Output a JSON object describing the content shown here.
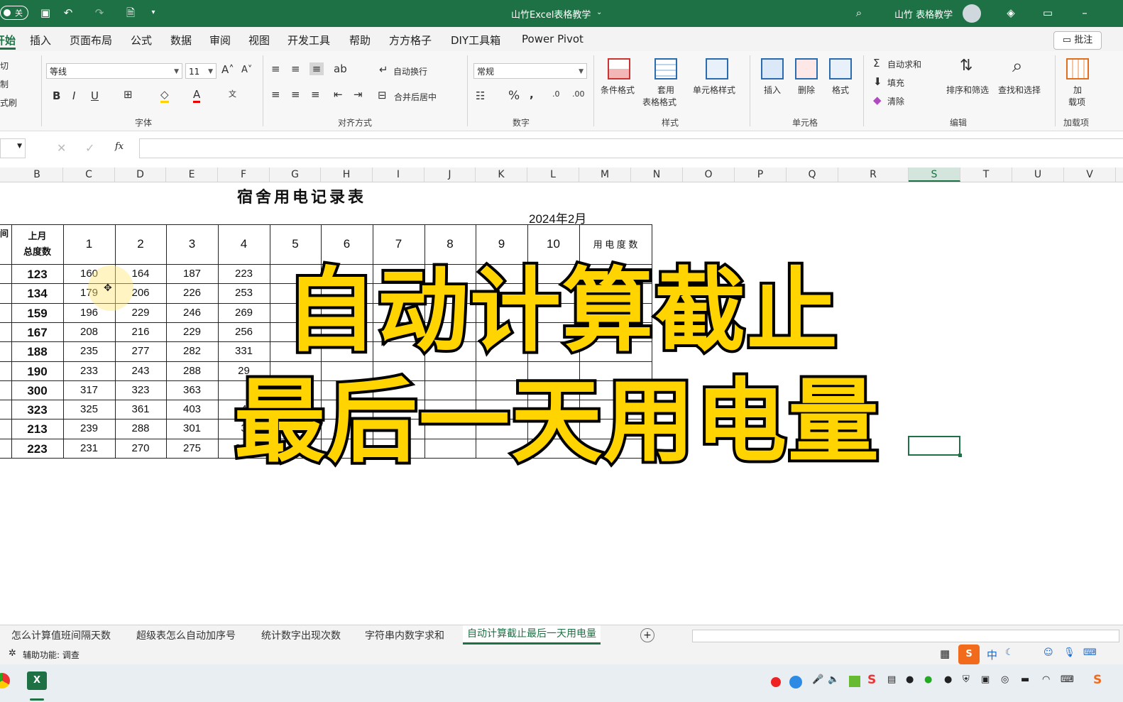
{
  "window": {
    "title": "山竹Excel表格教学",
    "autosave_label": "关",
    "user_name": "山竹 表格教学"
  },
  "menu": {
    "tabs": [
      "开始",
      "插入",
      "页面布局",
      "公式",
      "数据",
      "审阅",
      "视图",
      "开发工具",
      "帮助",
      "方方格子",
      "DIY工具箱",
      "Power Pivot"
    ],
    "active_tab": "开始",
    "comment_button": "批注"
  },
  "ribbon": {
    "clipboard": {
      "cut": "剪切",
      "copy": "复制",
      "format_painter": "格式刷"
    },
    "font": {
      "name": "等线",
      "size": "11",
      "label": "字体",
      "bold": "B",
      "italic": "I",
      "underline": "U"
    },
    "alignment": {
      "wrap_text": "自动换行",
      "merge_center": "合并后居中",
      "label": "对齐方式"
    },
    "number": {
      "format": "常规",
      "label": "数字",
      "percent": "%"
    },
    "styles": {
      "conditional": "条件格式",
      "table_format_1": "套用",
      "table_format_2": "表格格式",
      "cell_styles": "单元格样式",
      "label": "样式"
    },
    "cells": {
      "insert": "插入",
      "delete": "删除",
      "format": "格式",
      "label": "单元格"
    },
    "editing": {
      "autosum": "自动求和",
      "fill": "填充",
      "clear": "清除",
      "sort_filter": "排序和筛选",
      "find_select": "查找和选择",
      "label": "编辑"
    },
    "addins": {
      "label_1": "加",
      "label_2": "载项",
      "label": "加载项"
    }
  },
  "formula_bar": {
    "fx": "fx",
    "value": ""
  },
  "columns": [
    "B",
    "C",
    "D",
    "E",
    "F",
    "G",
    "H",
    "I",
    "J",
    "K",
    "L",
    "M",
    "N",
    "O",
    "P",
    "Q",
    "R",
    "S",
    "T",
    "U",
    "V"
  ],
  "selected_column": "S",
  "sheet": {
    "title": "宿舍用电记录表",
    "date": "2024年2月",
    "header_first_cell_fragment": "间",
    "header_prev_total_1": "上月",
    "header_prev_total_2": "总度数",
    "day_headers": [
      "1",
      "2",
      "3",
      "4",
      "5",
      "6",
      "7",
      "8",
      "9",
      "10"
    ],
    "last_header_fragment": "用 电 度 数",
    "rows": [
      [
        "123",
        "160",
        "164",
        "187",
        "223"
      ],
      [
        "134",
        "179",
        "206",
        "226",
        "253"
      ],
      [
        "159",
        "196",
        "229",
        "246",
        "269"
      ],
      [
        "167",
        "208",
        "216",
        "229",
        "256"
      ],
      [
        "188",
        "235",
        "277",
        "282",
        "331"
      ],
      [
        "190",
        "233",
        "243",
        "288",
        "29"
      ],
      [
        "300",
        "317",
        "323",
        "363",
        ""
      ],
      [
        "323",
        "325",
        "361",
        "403",
        "4"
      ],
      [
        "213",
        "239",
        "288",
        "301",
        "3"
      ],
      [
        "223",
        "231",
        "270",
        "275",
        "320"
      ]
    ]
  },
  "overlay": {
    "line1": "自动计算截止",
    "line2": "最后一天用电量"
  },
  "sheet_tabs": [
    "怎么计算值班间隔天数",
    "超级表怎么自动加序号",
    "统计数字出现次数",
    "字符串内数字求和",
    "自动计算截止最后一天用电量"
  ],
  "active_sheet_tab": "自动计算截止最后一天用电量",
  "status": {
    "accessibility": "辅助功能: 调查"
  },
  "taskbar": {
    "ime_label": "中"
  },
  "colors": {
    "excel_green": "#1e7145",
    "caption_yellow": "#ffd400"
  }
}
